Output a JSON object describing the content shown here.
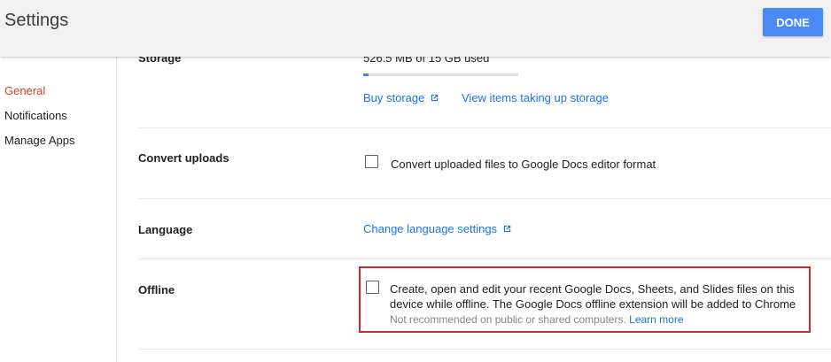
{
  "header": {
    "title": "Settings",
    "done_label": "DONE"
  },
  "sidebar": {
    "items": [
      {
        "label": "General",
        "active": true
      },
      {
        "label": "Notifications",
        "active": false
      },
      {
        "label": "Manage Apps",
        "active": false
      }
    ]
  },
  "storage": {
    "label": "Storage",
    "usage_text": "526.5 MB of 15 GB used",
    "used_fraction": 0.034,
    "buy_label": "Buy storage",
    "view_label": "View items taking up storage"
  },
  "convert": {
    "label": "Convert uploads",
    "checkbox_label": "Convert uploaded files to Google Docs editor format",
    "checked": false
  },
  "language": {
    "label": "Language",
    "link_label": "Change language settings"
  },
  "offline": {
    "label": "Offline",
    "description": "Create, open and edit your recent Google Docs, Sheets, and Slides files on this device while offline. The Google Docs offline extension will be added to Chrome",
    "note": "Not recommended on public or shared computers.",
    "learn_more": "Learn more",
    "checked": false
  },
  "colors": {
    "accent": "#4a8af4",
    "active_nav": "#d23f31",
    "link": "#1a73e8",
    "highlight_box": "#d5232f"
  },
  "icons": {
    "external_link": "external-link-icon"
  }
}
